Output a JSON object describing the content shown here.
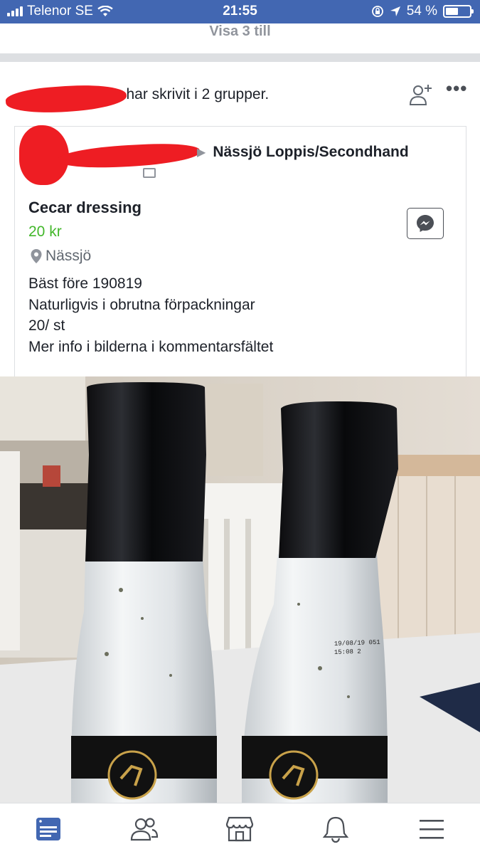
{
  "status_bar": {
    "carrier": "Telenor SE",
    "time": "21:55",
    "battery_percent": "54 %",
    "battery_level": 0.54,
    "icons": [
      "signal-bars-icon",
      "wifi-icon",
      "orientation-lock-icon",
      "location-arrow-icon",
      "battery-icon"
    ]
  },
  "feed": {
    "show_more_label": "Visa 3 till"
  },
  "post": {
    "author_suffix": "har skrivit i 2 grupper.",
    "group_name": "Nässjö Loppis/Secondhand",
    "actions": [
      "add-friend-icon",
      "more-options-icon"
    ]
  },
  "listing": {
    "title": "Cecar dressing",
    "price": "20 kr",
    "location": "Nässjö",
    "description": [
      "Bäst före 190819",
      "Naturligvis i obrutna förpackningar",
      "20/ st",
      "Mer info i bilderna i kommentarsfältet"
    ],
    "bottle_label_text": "19/08/19 051\n15:08 2"
  },
  "tab_bar": {
    "tabs": [
      "news-feed-icon",
      "friends-icon",
      "marketplace-icon",
      "notifications-icon",
      "menu-icon"
    ],
    "active_tab": "news-feed-icon",
    "active_color": "#4267b2",
    "inactive_color": "#4b4f56"
  },
  "colors": {
    "header_blue": "#4267b2",
    "price_green": "#42b72a",
    "redaction_red": "#ee1d23"
  }
}
